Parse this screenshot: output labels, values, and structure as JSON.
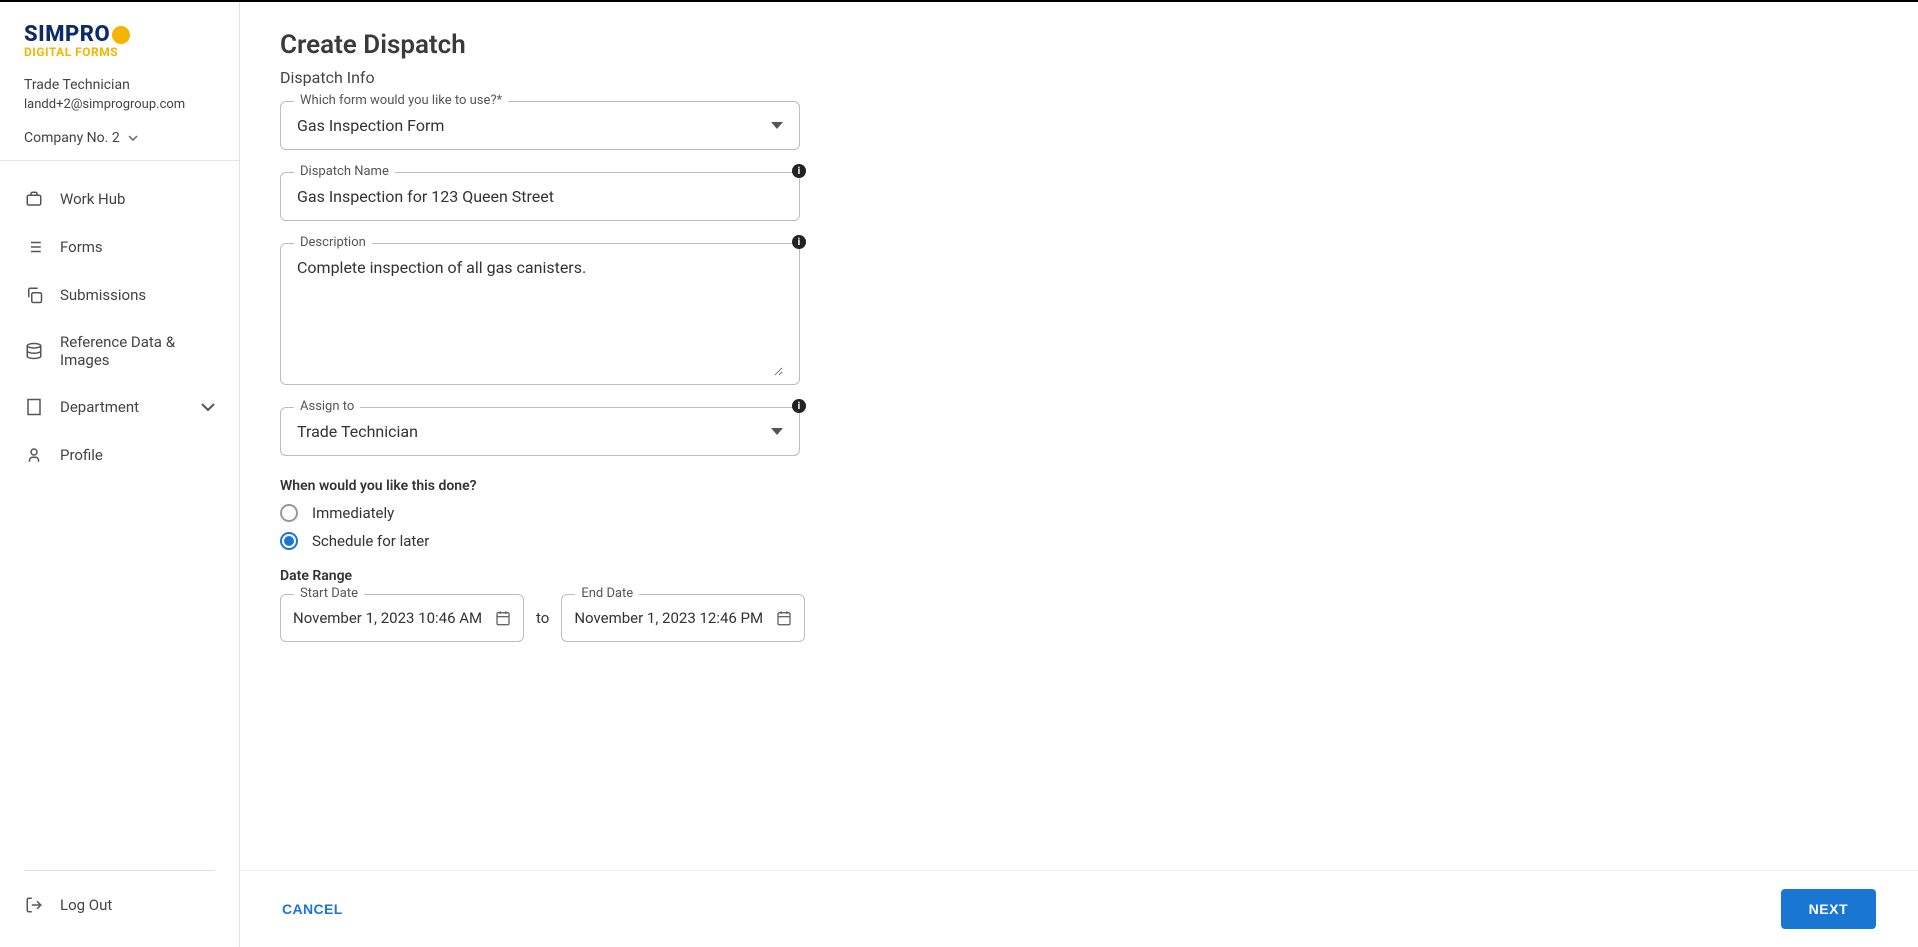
{
  "logo": {
    "main": "SIMPRO",
    "sub": "DIGITAL FORMS"
  },
  "user": {
    "name": "Trade Technician",
    "email": "landd+2@simprogroup.com"
  },
  "company": {
    "label": "Company No. 2"
  },
  "nav": {
    "items": [
      {
        "label": "Work Hub"
      },
      {
        "label": "Forms"
      },
      {
        "label": "Submissions"
      },
      {
        "label": "Reference Data & Images"
      },
      {
        "label": "Department"
      },
      {
        "label": "Profile"
      }
    ],
    "logout": "Log Out"
  },
  "page": {
    "title": "Create Dispatch",
    "section": "Dispatch Info",
    "form_field": {
      "label": "Which form would you like to use?*",
      "value": "Gas Inspection Form"
    },
    "dispatch_name": {
      "label": "Dispatch Name",
      "value": "Gas Inspection for 123 Queen Street"
    },
    "description": {
      "label": "Description",
      "value": "Complete inspection of all gas canisters."
    },
    "assign_to": {
      "label": "Assign to",
      "value": "Trade Technician"
    },
    "when_question": "When would you like this done?",
    "when_options": {
      "immediately": "Immediately",
      "schedule": "Schedule for later"
    },
    "date_range_label": "Date Range",
    "start_date": {
      "label": "Start Date",
      "value": "November 1, 2023 10:46 AM"
    },
    "to": "to",
    "end_date": {
      "label": "End Date",
      "value": "November 1, 2023 12:46 PM"
    }
  },
  "footer": {
    "cancel": "CANCEL",
    "next": "NEXT"
  }
}
